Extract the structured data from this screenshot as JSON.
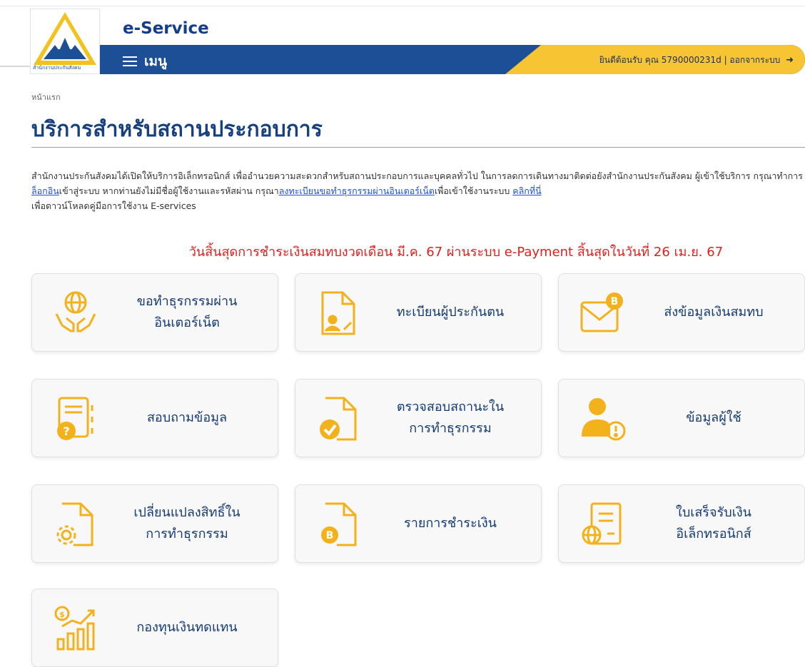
{
  "header": {
    "logo_caption": "สำนักงานประกันสังคม",
    "brand": "e-Service",
    "menu_label": "เมนู",
    "welcome_text": "ยินดีต้อนรับ คุณ 5790000231d | ออกจากระบบ"
  },
  "breadcrumb": "หน้าแรก",
  "page_title": "บริการสำหรับสถานประกอบการ",
  "intro": {
    "part1": "สำนักงานประกันสังคมได้เปิดให้บริการอิเล็กทรอนิกส์ เพื่ออำนวยความสะดวกสำหรับสถานประกอบการและบุคคลทั่วไป ในการลดการเดินทางมาติดต่อยังสำนักงานประกันสังคม ผู้เข้าใช้บริการ กรุณาทำการ",
    "link_login": "ล็อกอิน",
    "part2": "เข้าสู่ระบบ หากท่านยังไม่มีชื่อผู้ใช้งานและรหัสผ่าน กรุณา",
    "link_register": "ลงทะเบียนขอทำธุรกรรมผ่านอินเตอร์เน็ต",
    "part3": "เพื่อเข้าใช้งานระบบ ",
    "link_click": "คลิกที่นี่",
    "part4": "เพื่อดาวน์โหลดคู่มือการใช้งาน E-services"
  },
  "notice": "วันสิ้นสุดการชำระเงินสมทบงวดเดือน มี.ค. 67 ผ่านระบบ e-Payment สิ้นสุดในวันที่ 26 เม.ย. 67",
  "cards": [
    {
      "label": "ขอทำธุรกรรมผ่าน\nอินเตอร์เน็ต",
      "icon": "globe-hands-icon"
    },
    {
      "label": "ทะเบียนผู้ประกันตน",
      "icon": "document-user-edit-icon"
    },
    {
      "label": "ส่งข้อมูลเงินสมทบ",
      "icon": "envelope-coin-icon"
    },
    {
      "label": "สอบถามข้อมูล",
      "icon": "notebook-question-icon"
    },
    {
      "label": "ตรวจสอบสถานะใน\nการทำธุรกรรม",
      "icon": "document-check-icon"
    },
    {
      "label": "ข้อมูลผู้ใช้",
      "icon": "user-info-icon"
    },
    {
      "label": "เปลี่ยนแปลงสิทธิ์ใน\nการทำธุรกรรม",
      "icon": "document-gear-icon"
    },
    {
      "label": "รายการชำระเงิน",
      "icon": "document-coin-icon"
    },
    {
      "label": "ใบเสร็จรับเงิน\nอิเล็กทรอนิกส์",
      "icon": "receipt-globe-icon"
    },
    {
      "label": "กองทุนเงินทดแทน",
      "icon": "coin-growth-chart-icon"
    }
  ],
  "colors": {
    "primary": "#1d4f96",
    "accent": "#f7c533",
    "notice": "#e01f1f",
    "icon": "#f3b21b"
  }
}
